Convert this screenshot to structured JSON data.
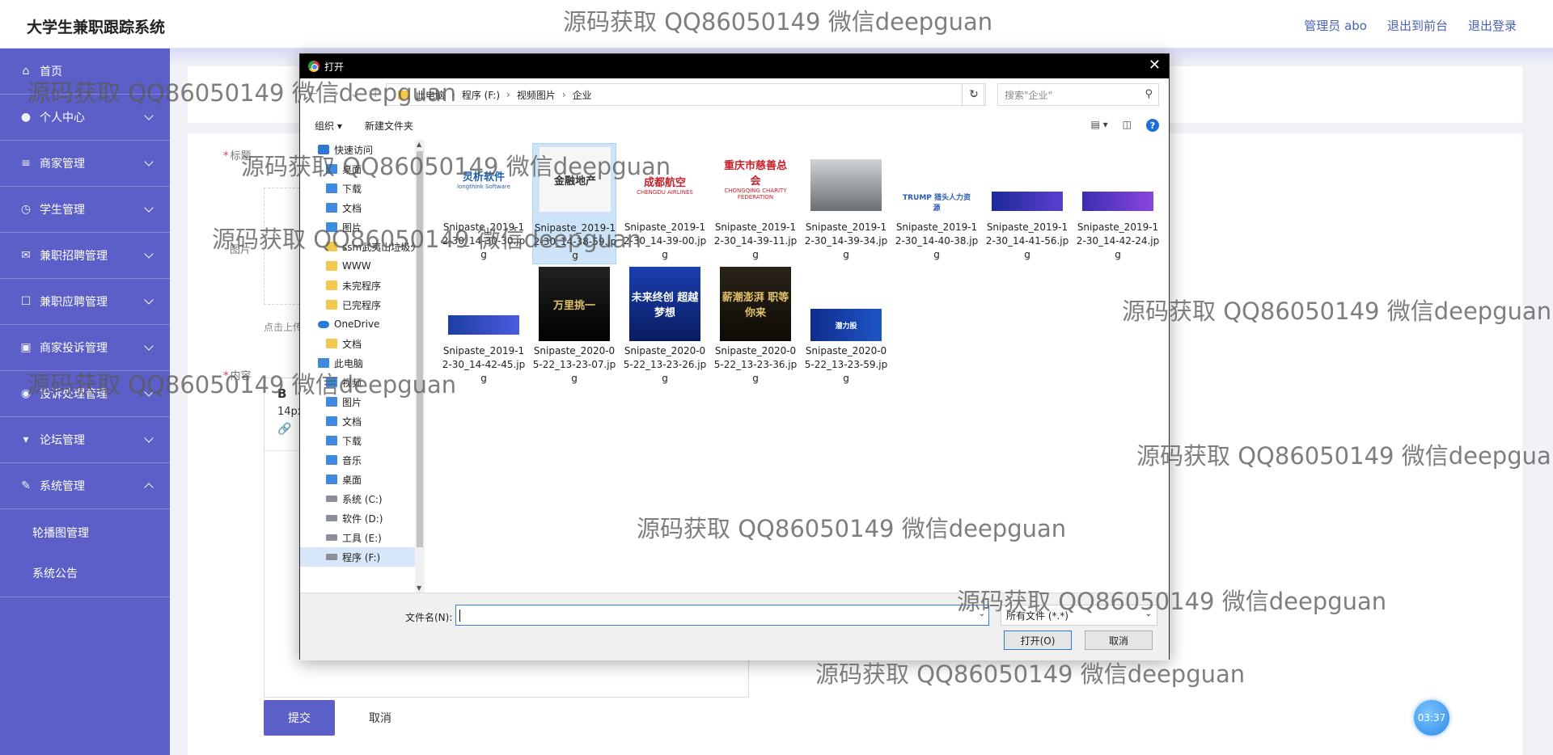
{
  "header": {
    "brand": "大学生兼职跟踪系统",
    "admin": "管理员 abo",
    "to_front": "退出到前台",
    "logout": "退出登录"
  },
  "sidebar": {
    "items": [
      {
        "label": "首页",
        "icon": "home-icon"
      },
      {
        "label": "个人中心",
        "icon": "user-icon"
      },
      {
        "label": "商家管理",
        "icon": "list-icon"
      },
      {
        "label": "学生管理",
        "icon": "clock-icon"
      },
      {
        "label": "兼职招聘管理",
        "icon": "mail-icon"
      },
      {
        "label": "兼职应聘管理",
        "icon": "chat-icon"
      },
      {
        "label": "商家投诉管理",
        "icon": "bag-icon"
      },
      {
        "label": "投诉处理管理",
        "icon": "compass-icon"
      },
      {
        "label": "论坛管理",
        "icon": "cup-icon"
      },
      {
        "label": "系统管理",
        "icon": "edit-icon"
      }
    ],
    "sub_items": [
      "轮播图管理",
      "系统公告"
    ]
  },
  "form": {
    "title_label": "标题",
    "image_label": "图片",
    "upload_hint": "点击上传",
    "content_label": "内容",
    "editor_bold": "B",
    "editor_size": "14px",
    "submit": "提交",
    "cancel": "取消",
    "clock": "03:37"
  },
  "dialog": {
    "title": "打开",
    "breadcrumb": [
      "此电脑",
      "程序 (F:)",
      "视频图片",
      "企业"
    ],
    "search_placeholder": "搜索\"企业\"",
    "organize": "组织 ▾",
    "new_folder": "新建文件夹",
    "tree": [
      {
        "label": "快速访问",
        "type": "star"
      },
      {
        "label": "桌面",
        "type": "blue",
        "indent": 1
      },
      {
        "label": "下载",
        "type": "blue",
        "indent": 1
      },
      {
        "label": "文档",
        "type": "blue",
        "indent": 1
      },
      {
        "label": "图片",
        "type": "blue",
        "indent": 1
      },
      {
        "label": "ssm武夷山垃圾分",
        "type": "folder",
        "indent": 1
      },
      {
        "label": "WWW",
        "type": "folder",
        "indent": 1
      },
      {
        "label": "未完程序",
        "type": "folder",
        "indent": 1
      },
      {
        "label": "已完程序",
        "type": "folder",
        "indent": 1
      },
      {
        "label": "OneDrive",
        "type": "cloud"
      },
      {
        "label": "文档",
        "type": "folder",
        "indent": 1
      },
      {
        "label": "此电脑",
        "type": "blue"
      },
      {
        "label": "视频",
        "type": "blue",
        "indent": 1
      },
      {
        "label": "图片",
        "type": "blue",
        "indent": 1
      },
      {
        "label": "文档",
        "type": "blue",
        "indent": 1
      },
      {
        "label": "下载",
        "type": "blue",
        "indent": 1
      },
      {
        "label": "音乐",
        "type": "blue",
        "indent": 1
      },
      {
        "label": "桌面",
        "type": "blue",
        "indent": 1
      },
      {
        "label": "系统 (C:)",
        "type": "drive",
        "indent": 1
      },
      {
        "label": "软件 (D:)",
        "type": "drive",
        "indent": 1
      },
      {
        "label": "工具 (E:)",
        "type": "drive",
        "indent": 1
      },
      {
        "label": "程序 (F:)",
        "type": "drive",
        "indent": 1,
        "selected": true
      }
    ],
    "files": [
      {
        "name": "Snipaste_2019-12-30_14-30-30.jpg",
        "thumb": "灵析软件",
        "caption": "longthink Software"
      },
      {
        "name": "Snipaste_2019-12-30_14-38-59.jpg",
        "thumb": "金融地产",
        "selected": true
      },
      {
        "name": "Snipaste_2019-12-30_14-39-00.jpg",
        "thumb": "成都航空",
        "caption": "CHENGDU AIRLINES"
      },
      {
        "name": "Snipaste_2019-12-30_14-39-11.jpg",
        "thumb": "重庆市慈善总会",
        "caption": "CHONGQING CHARITY FEDERATION"
      },
      {
        "name": "Snipaste_2019-12-30_14-39-34.jpg",
        "thumb": ""
      },
      {
        "name": "Snipaste_2019-12-30_14-40-38.jpg",
        "thumb": "TRUMP 猎头人力资源"
      },
      {
        "name": "Snipaste_2019-12-30_14-41-56.jpg",
        "thumb": ""
      },
      {
        "name": "Snipaste_2019-12-30_14-42-24.jpg",
        "thumb": ""
      },
      {
        "name": "Snipaste_2019-12-30_14-42-45.jpg",
        "thumb": ""
      },
      {
        "name": "Snipaste_2020-05-22_13-23-07.jpg",
        "thumb": "万里挑一"
      },
      {
        "name": "Snipaste_2020-05-22_13-23-26.jpg",
        "thumb": "未来终创 超越梦想"
      },
      {
        "name": "Snipaste_2020-05-22_13-23-36.jpg",
        "thumb": "薪潮澎湃 职等你来"
      },
      {
        "name": "Snipaste_2020-05-22_13-23-59.jpg",
        "thumb": "潜力股"
      }
    ],
    "filename_label": "文件名(N):",
    "filename_value": "",
    "filter": "所有文件 (*.*)",
    "open": "打开(O)",
    "cancel": "取消"
  },
  "watermark": "源码获取 QQ86050149 微信deepguan",
  "colors": {
    "sidebar": "#5b5fc7",
    "accent": "#5b5fc7"
  }
}
